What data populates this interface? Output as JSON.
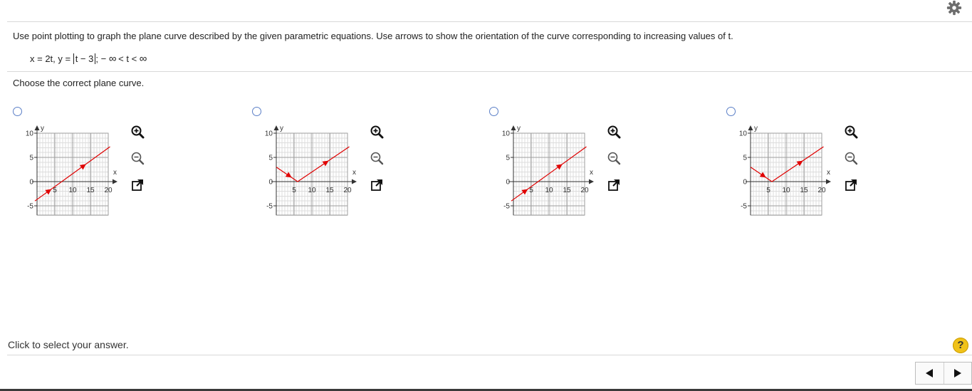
{
  "question": {
    "instruction": "Use point plotting to graph the plane curve described by the given parametric equations. Use arrows to show the orientation of the curve corresponding to increasing values of t.",
    "equation": {
      "x_part": "x = 2t, y = ",
      "abs_inner": "t − 3",
      "after_abs": ";  −",
      "inf1": "∞",
      "mid": " < t < ",
      "inf2": "∞"
    },
    "prompt": "Choose the correct plane curve."
  },
  "graph_labels": {
    "y_axis": "y",
    "x_axis": "x",
    "y_ticks": [
      "10",
      "5",
      "0",
      "-5"
    ],
    "x_ticks": [
      "5",
      "10",
      "15",
      "20"
    ]
  },
  "options": [
    {
      "id": "A",
      "curve": "line",
      "selected": false
    },
    {
      "id": "B",
      "curve": "v-shape",
      "selected": false
    },
    {
      "id": "C",
      "curve": "line",
      "selected": false
    },
    {
      "id": "D",
      "curve": "v-shape",
      "selected": false
    }
  ],
  "curve_color": "#e00000",
  "footer": {
    "hint": "Click to select your answer.",
    "help_label": "?"
  }
}
